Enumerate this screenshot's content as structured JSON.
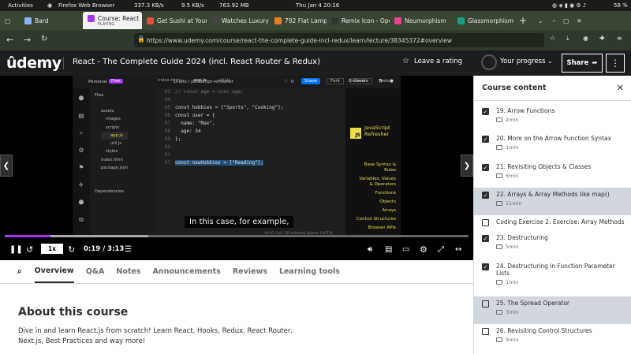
{
  "system": {
    "activities": "Activities",
    "app_name": "Firefox Web Browser",
    "net_down": "337.3 KB/s",
    "net_up": "9.5 KB/s",
    "mem": "763.92 MB",
    "clock": "Thu Jan 4  20:16",
    "battery": "58 %"
  },
  "tabs": [
    {
      "label": "Bard",
      "color": "#8ab4f8"
    },
    {
      "label": "Course: React",
      "sub": "PLAYING",
      "color": "#a435f0",
      "active": true
    },
    {
      "label": "Get Sushi at Your Cr",
      "color": "#e74c3c"
    },
    {
      "label": "Watches Luxury",
      "color": "#444"
    },
    {
      "label": "792 Flat Lamp I",
      "color": "#e67e22"
    },
    {
      "label": "Remix Icon - Open",
      "color": "#333"
    },
    {
      "label": "Neumorphism",
      "color": "#e84393"
    },
    {
      "label": "Glassmorphism",
      "color": "#16a085"
    }
  ],
  "browser": {
    "url": "https://www.udemy.com/course/react-the-complete-guide-incl-redux/learn/lecture/38345372#overview"
  },
  "header": {
    "logo": "ûdemy",
    "course_title": "React - The Complete Guide 2024 (incl. React Router & Redux)",
    "rate": "Leave a rating",
    "progress": "Your progress",
    "share": "Share",
    "more": "⋮"
  },
  "ide": {
    "personal": "Personal",
    "free": "Free",
    "breadcrumb": "Drafts  /  javascript-refresher",
    "likes": "0",
    "share": "Share",
    "fork": "Fork",
    "create": "Create",
    "files_title": "Files",
    "file_tabs": [
      "index.html",
      "app.js",
      "util.js"
    ],
    "right_tabs": [
      "Browser",
      "Tests"
    ],
    "tree": [
      "assets",
      "images",
      "scripts",
      "app.js",
      "util.js",
      "styles",
      "index.html",
      "package.json"
    ],
    "deps": "Dependencies",
    "js_badge": "JS",
    "js_title": "JavaScript Refresher",
    "nav": [
      "Base Syntax & Rules",
      "Variables, Values & Operators",
      "Functions",
      "Objects",
      "Arrays",
      "Control Structures",
      "Browser APIs"
    ],
    "status": "Ln 97, Col 1 (31 selected)   Spaces: 2   UTF-8"
  },
  "code": [
    {
      "n": "93",
      "t": "// const age = user.age;"
    },
    {
      "n": "94",
      "t": ""
    },
    {
      "n": "95",
      "t": "const hobbies = [\"Sports\", \"Cooking\"];"
    },
    {
      "n": "96",
      "t": "const user = {"
    },
    {
      "n": "97",
      "t": "  name: \"Max\","
    },
    {
      "n": "98",
      "t": "  age: 34"
    },
    {
      "n": "99",
      "t": "};"
    },
    {
      "n": "00",
      "t": ""
    },
    {
      "n": "01",
      "t": ""
    },
    {
      "n": "97",
      "t": "const newHobbies = [\"Reading\"];"
    }
  ],
  "player": {
    "caption": "In this case, for example,",
    "speed": "1x",
    "time": "0:19 / 3:13",
    "progress": 0.099,
    "buffered": 0.31
  },
  "course_tabs": [
    "Overview",
    "Q&A",
    "Notes",
    "Announcements",
    "Reviews",
    "Learning tools"
  ],
  "about": {
    "title": "About this course",
    "desc": "Dive in and learn React.js from scratch! Learn React, Hooks, Redux, React Router, Next.js, Best Practices and way more!"
  },
  "sidebar": {
    "title": "Course content",
    "items": [
      {
        "title": "19. Arrow Functions",
        "dur": "2min",
        "checked": true
      },
      {
        "title": "20. More on the Arrow Function Syntax",
        "dur": "1min",
        "checked": true
      },
      {
        "title": "21. Revisiting Objects & Classes",
        "dur": "6min",
        "checked": true
      },
      {
        "title": "22. Arrays & Array Methods like map()",
        "dur": "11min",
        "checked": true,
        "hl": true
      },
      {
        "title": "Coding Exercise 2: Exercise: Array Methods",
        "dur": "",
        "checked": false
      },
      {
        "title": "23. Destructuring",
        "dur": "5min",
        "checked": true
      },
      {
        "title": "24. Destructuring in Function Parameter Lists",
        "dur": "1min",
        "checked": true
      },
      {
        "title": "25. The Spread Operator",
        "dur": "3min",
        "checked": false,
        "hl": true
      },
      {
        "title": "26. Revisiting Control Structures",
        "dur": "5min",
        "checked": false
      }
    ]
  }
}
